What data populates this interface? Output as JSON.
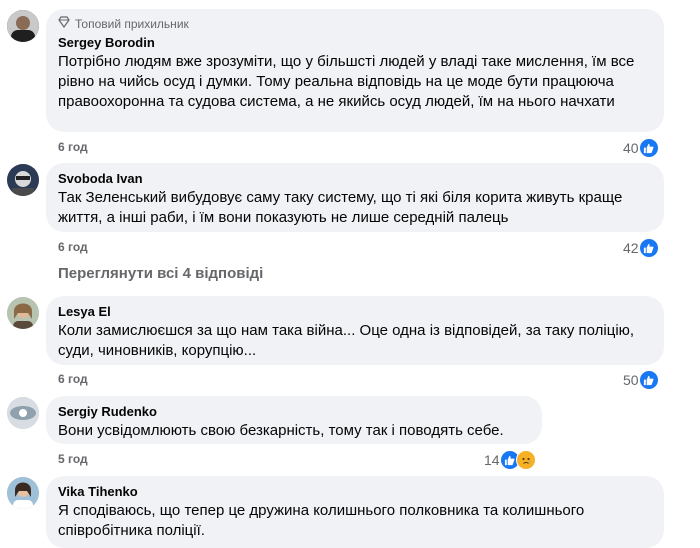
{
  "comments": [
    {
      "badge": "Топовий прихильник",
      "author": "Sergey Borodin",
      "text": "Потрібно людям вже зрозуміти, що у більшсті людей у владі таке мислення, їм все рівно на чийсь осуд і думки. Тому реальна відповідь на це моде бути працююча правоохоронна та судова система, а не якийсь осуд людей, їм на нього начхати",
      "time": "6 год",
      "likes": "40"
    },
    {
      "author": "Svoboda Ivan",
      "text": "Так Зеленський вибудовує саму таку систему, що ті які біля корита живуть краще життя, а інші раби, і їм вони показують не лише середній палець",
      "time": "6 год",
      "likes": "42"
    },
    {
      "author": "Lesya El",
      "text": "Коли замислюєшся за що нам така війна... Оце одна із відповідей, за таку поліцію, суди, чиновників, корупцію...",
      "time": "6 год",
      "likes": "50"
    },
    {
      "author": "Sergiy Rudenko",
      "text": "Вони усвідомлюють свою безкарність, тому так і поводять себе.",
      "time": "5 год",
      "likes": "14"
    },
    {
      "author": "Vika Tihenko",
      "text": "Я сподіваюсь, що тепер це дружина колишнього полковника та колишнього співробітника поліції."
    }
  ],
  "view_replies": "Переглянути всі 4 відповіді",
  "colors": {
    "like": "#1877f2",
    "bubble": "#f0f2f5",
    "meta": "#65676b"
  },
  "icons": {
    "badge": "diamond-icon",
    "like": "thumbs-up-icon",
    "sad": "sad-face-icon"
  }
}
